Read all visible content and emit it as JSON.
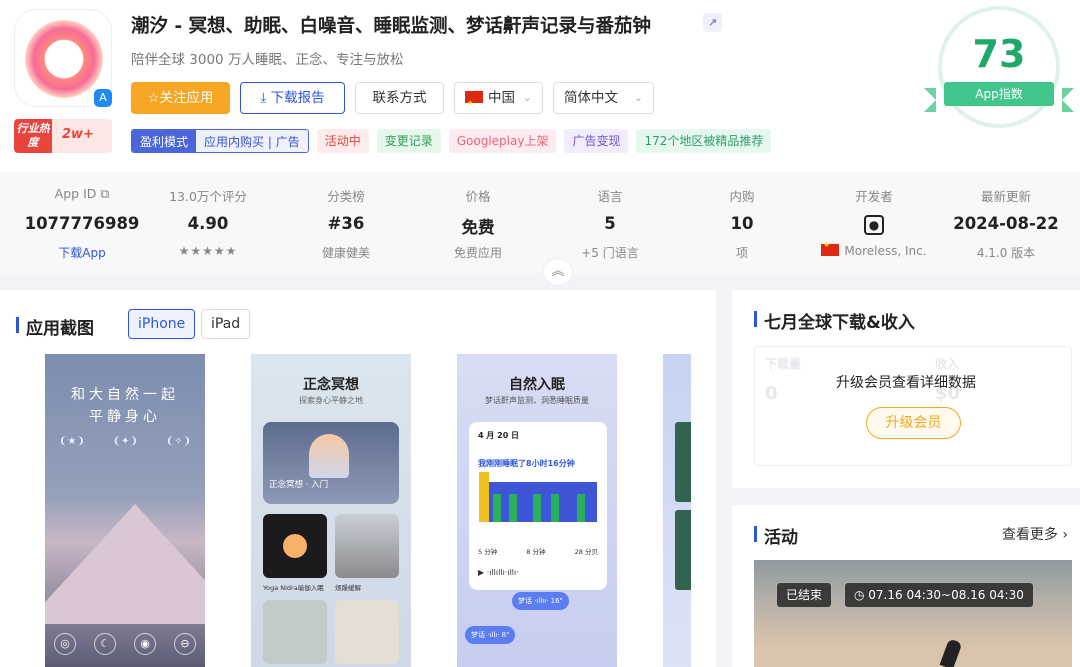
{
  "app": {
    "title": "潮汐 - 冥想、助眠、白噪音、睡眠监测、梦话鼾声记录与番茄钟",
    "subtitle": "陪伴全球 3000 万人睡眠、正念、专注与放松",
    "heat_label": "行业热度",
    "heat_value": "2w+",
    "open_icon": "external-link-icon"
  },
  "buttons": {
    "follow": "☆关注应用",
    "download_report": "⤓ 下载报告",
    "contact": "联系方式",
    "country": "中国",
    "language": "简体中文"
  },
  "tags": {
    "mode_label": "盈利模式",
    "mode_value": "应用内购买 | 广告",
    "items": [
      "活动中",
      "变更记录",
      "Googleplay上架",
      "广告变现",
      "172个地区被精品推荐"
    ]
  },
  "score": {
    "value": "73",
    "label": "App指数",
    "color": "#1ea86a"
  },
  "stats": {
    "app_id": {
      "label": "App ID",
      "value": "1077776989",
      "sub": "下载App"
    },
    "rating": {
      "label": "13.0万个评分",
      "value": "4.90",
      "stars": "★★★★★"
    },
    "category": {
      "label": "分类榜",
      "value": "#36",
      "sub": "健康健美"
    },
    "price": {
      "label": "价格",
      "value": "免费",
      "sub": "免费应用"
    },
    "languages": {
      "label": "语言",
      "value": "5",
      "sub": "+5 门语言"
    },
    "iap": {
      "label": "内购",
      "value": "10",
      "sub": "项"
    },
    "developer": {
      "label": "开发者",
      "sub": "Moreless, Inc."
    },
    "updated": {
      "label": "最新更新",
      "value": "2024-08-22",
      "sub": "4.1.0 版本"
    }
  },
  "screenshots": {
    "title": "应用截图",
    "tabs": [
      "iPhone",
      "iPad"
    ],
    "shot1": {
      "line1": "和大自然一起",
      "line2": "平静身心"
    },
    "shot2": {
      "title": "正念冥想",
      "subtitle": "探索身心平静之地",
      "card": "正念冥想 · 入门",
      "cap1": "Yoga Nidra瑜伽入眠",
      "cap2": "烦躁缓解"
    },
    "shot3": {
      "title": "自然入眠",
      "subtitle": "梦话鼾声监测，洞悉睡眠质量",
      "date": "4 月 20 日",
      "headline": "我刚刚睡眠了8小时16分钟",
      "m1": "5 分钟",
      "m2": "8 分钟",
      "m3": "28 分贝",
      "bubble1": "梦话 ·ıllıı· 16\"",
      "bubble2": "梦话 ·ıllı· 8\""
    }
  },
  "downloads": {
    "title": "七月全球下载&收入",
    "locked_text": "升级会员查看详细数据",
    "upgrade": "升级会员"
  },
  "activity": {
    "title": "活动",
    "more": "查看更多 ›",
    "status": "已结束",
    "time": "◷ 07.16 04:30~08.16 04:30"
  }
}
